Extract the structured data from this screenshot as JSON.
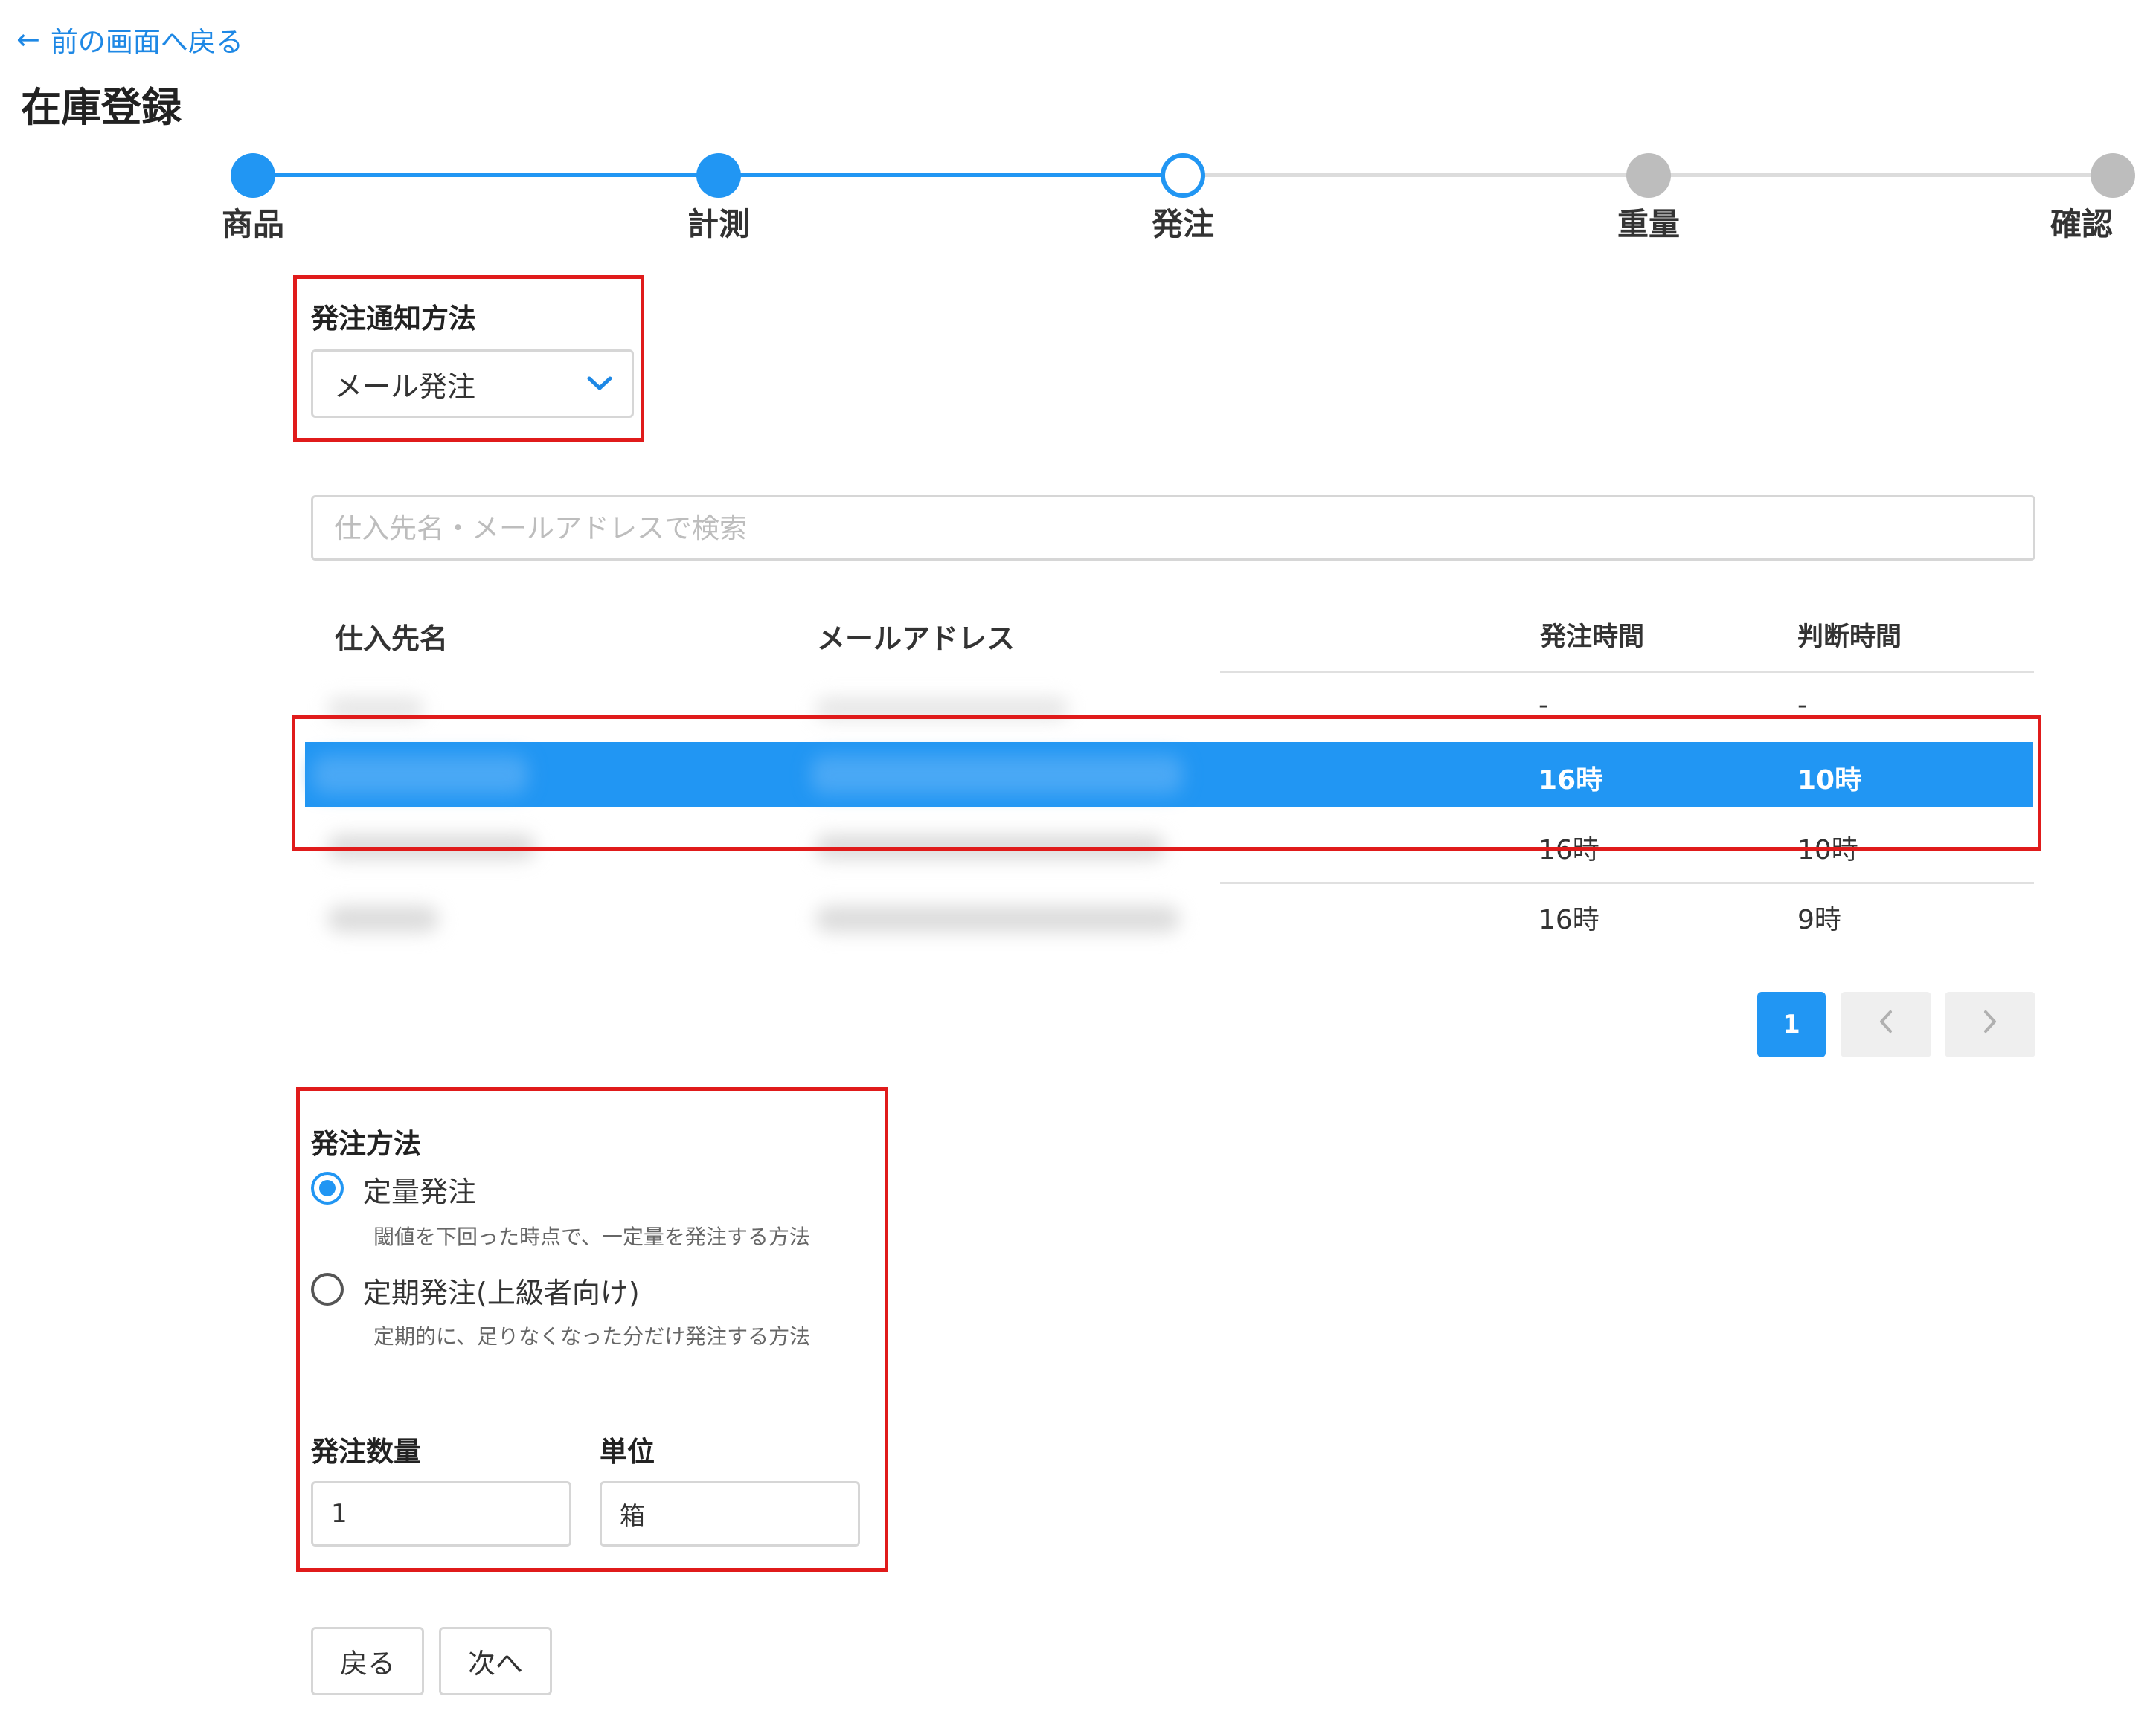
{
  "header": {
    "back_link": "前の画面へ戻る",
    "title": "在庫登録"
  },
  "stepper": {
    "steps": [
      {
        "label": "商品",
        "state": "done"
      },
      {
        "label": "計測",
        "state": "done"
      },
      {
        "label": "発注",
        "state": "current"
      },
      {
        "label": "重量",
        "state": "todo"
      },
      {
        "label": "確認",
        "state": "todo"
      }
    ],
    "colors": {
      "done": "#2196f3",
      "todo": "#bdbdbd"
    }
  },
  "notification": {
    "label": "発注通知方法",
    "selected": "メール発注"
  },
  "search": {
    "placeholder": "仕入先名・メールアドレスで検索"
  },
  "table": {
    "headers": [
      "仕入先名",
      "メールアドレス",
      "発注時間",
      "判断時間"
    ],
    "rows": [
      {
        "order_time": "-",
        "judge_time": "-",
        "selected": false
      },
      {
        "order_time": "16時",
        "judge_time": "10時",
        "selected": true
      },
      {
        "order_time": "16時",
        "judge_time": "10時",
        "selected": false
      },
      {
        "order_time": "16時",
        "judge_time": "9時",
        "selected": false
      }
    ]
  },
  "pagination": {
    "current": "1",
    "prev_icon": "chevron-left-icon",
    "next_icon": "chevron-right-icon"
  },
  "order_method": {
    "label": "発注方法",
    "options": [
      {
        "label": "定量発注",
        "desc": "閾値を下回った時点で、一定量を発注する方法",
        "checked": true
      },
      {
        "label": "定期発注(上級者向け)",
        "desc": "定期的に、足りなくなった分だけ発注する方法",
        "checked": false
      }
    ]
  },
  "quantity": {
    "label": "発注数量",
    "value": "1"
  },
  "unit": {
    "label": "単位",
    "value": "箱"
  },
  "buttons": {
    "back": "戻る",
    "next": "次へ"
  },
  "colors": {
    "accent": "#2196f3",
    "highlight": "#e01b1b"
  }
}
